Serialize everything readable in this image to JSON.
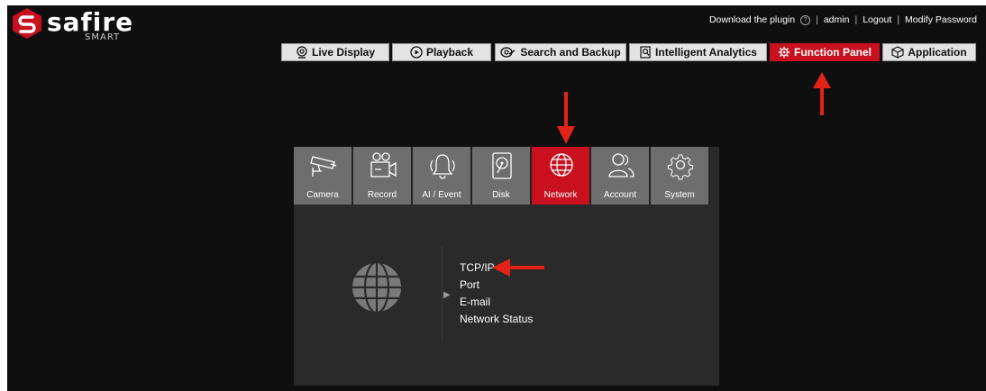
{
  "brand": {
    "name": "safire",
    "sub": "SMART",
    "accent": "#c8101e"
  },
  "top_links": {
    "download": "Download the plugin",
    "help_glyph": "?",
    "sep": "|",
    "user": "admin",
    "logout": "Logout",
    "modify": "Modify Password"
  },
  "tabs": [
    {
      "label": "Live Display",
      "icon": "live-display-icon",
      "active": false
    },
    {
      "label": "Playback",
      "icon": "playback-icon",
      "active": false
    },
    {
      "label": "Search and Backup",
      "icon": "search-backup-icon",
      "active": false
    },
    {
      "label": "Intelligent Analytics",
      "icon": "intelligent-analytics-icon",
      "active": false
    },
    {
      "label": "Function Panel",
      "icon": "function-panel-gear-icon",
      "active": true
    },
    {
      "label": "Application",
      "icon": "application-cube-icon",
      "active": false
    }
  ],
  "categories": [
    {
      "label": "Camera",
      "icon": "camera-icon",
      "active": false
    },
    {
      "label": "Record",
      "icon": "record-icon",
      "active": false
    },
    {
      "label": "AI / Event",
      "icon": "ai-event-bell-icon",
      "active": false
    },
    {
      "label": "Disk",
      "icon": "disk-icon",
      "active": false
    },
    {
      "label": "Network",
      "icon": "network-globe-icon",
      "active": true
    },
    {
      "label": "Account",
      "icon": "account-icon",
      "active": false
    },
    {
      "label": "System",
      "icon": "system-gear-icon",
      "active": false
    }
  ],
  "network_menu": {
    "items": [
      "TCP/IP",
      "Port",
      "E-mail",
      "Network Status"
    ],
    "pointer": "▶"
  }
}
